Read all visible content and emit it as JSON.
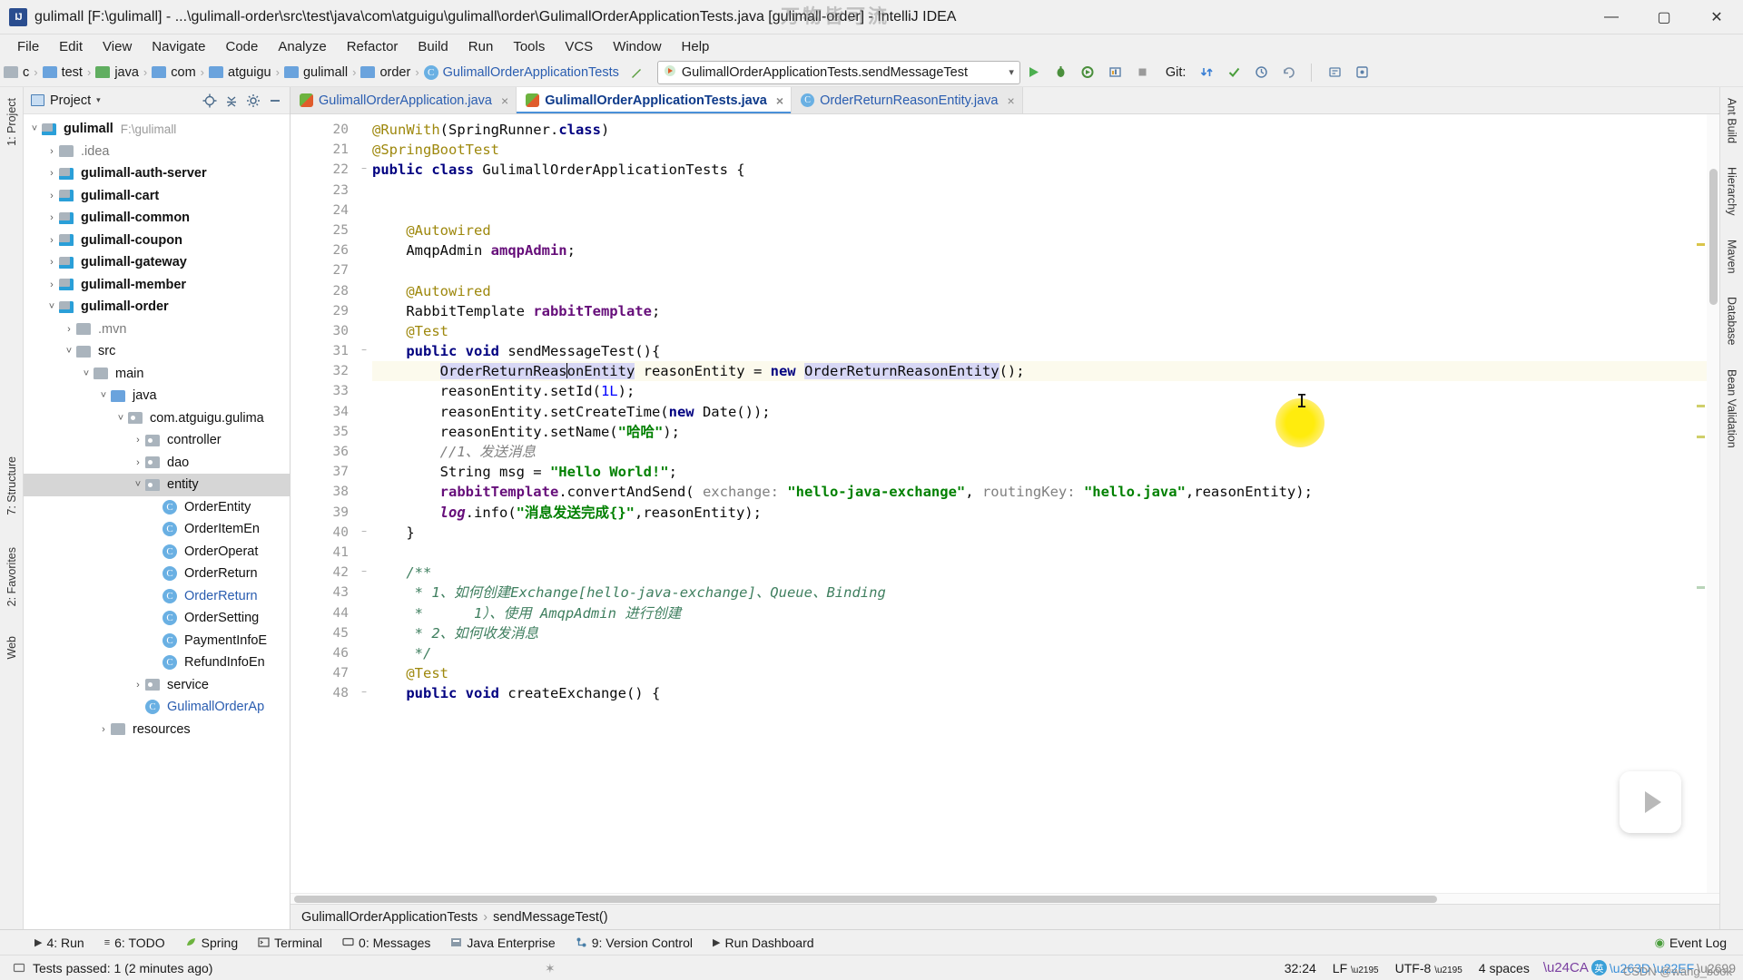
{
  "window": {
    "title": "gulimall [F:\\gulimall] - ...\\gulimall-order\\src\\test\\java\\com\\atguigu\\gulimall\\order\\GulimallOrderApplicationTests.java [gulimall-order] - IntelliJ IDEA",
    "app_icon_text": "IJ",
    "watermark": "万物皆可流",
    "minimize": "—",
    "maximize": "▢",
    "close": "✕"
  },
  "menubar": {
    "items": [
      "File",
      "Edit",
      "View",
      "Navigate",
      "Code",
      "Analyze",
      "Refactor",
      "Build",
      "Run",
      "Tools",
      "VCS",
      "Window",
      "Help"
    ]
  },
  "navbar": {
    "crumbs": [
      {
        "label": "c",
        "icon": "folder-icon",
        "color": "grey"
      },
      {
        "label": "test",
        "icon": "folder-icon",
        "color": "blue"
      },
      {
        "label": "java",
        "icon": "folder-icon",
        "color": "green"
      },
      {
        "label": "com",
        "icon": "folder-icon",
        "color": "blue"
      },
      {
        "label": "atguigu",
        "icon": "folder-icon",
        "color": "blue"
      },
      {
        "label": "gulimall",
        "icon": "folder-icon",
        "color": "blue"
      },
      {
        "label": "order",
        "icon": "folder-icon",
        "color": "blue"
      },
      {
        "label": "GulimallOrderApplicationTests",
        "icon": "class-icon",
        "color": "link"
      }
    ],
    "separator": "›",
    "run_config": "GulimallOrderApplicationTests.sendMessageTest",
    "run_config_caret": "▾",
    "git_label": "Git:",
    "buttons": {
      "run": "▶",
      "debug": "bug-icon",
      "run_with_coverage": "coverage-icon",
      "profile": "profile-icon",
      "stop": "■",
      "update_project": "↙",
      "commit": "✓",
      "history": "◴",
      "rollback": "↶",
      "search_everywhere": "⌕",
      "settings": "⚙"
    }
  },
  "left_strips": [
    {
      "label": "1: Project",
      "name": "tool-tab-project"
    },
    {
      "label": "7: Structure",
      "name": "tool-tab-structure"
    },
    {
      "label": "2: Favorites",
      "name": "tool-tab-favorites"
    },
    {
      "label": "Web",
      "name": "tool-tab-web"
    }
  ],
  "right_strips": [
    {
      "label": "Ant Build",
      "name": "tool-tab-ant-build"
    },
    {
      "label": "Hierarchy",
      "name": "tool-tab-hierarchy"
    },
    {
      "label": "Maven",
      "name": "tool-tab-maven"
    },
    {
      "label": "Database",
      "name": "tool-tab-database"
    },
    {
      "label": "Bean Validation",
      "name": "tool-tab-bean-validation"
    }
  ],
  "project_panel": {
    "title": "Project",
    "caret": "▾",
    "tree": [
      {
        "indent": 0,
        "arrow": "˅",
        "icon": "module-folder",
        "label": "gulimall",
        "bold": true,
        "path": "F:\\gulimall"
      },
      {
        "indent": 1,
        "arrow": "›",
        "icon": "folder",
        "label": ".idea",
        "dim": true
      },
      {
        "indent": 1,
        "arrow": "›",
        "icon": "module-folder",
        "label": "gulimall-auth-server",
        "bold": true
      },
      {
        "indent": 1,
        "arrow": "›",
        "icon": "module-folder",
        "label": "gulimall-cart",
        "bold": true
      },
      {
        "indent": 1,
        "arrow": "›",
        "icon": "module-folder",
        "label": "gulimall-common",
        "bold": true
      },
      {
        "indent": 1,
        "arrow": "›",
        "icon": "module-folder",
        "label": "gulimall-coupon",
        "bold": true
      },
      {
        "indent": 1,
        "arrow": "›",
        "icon": "module-folder",
        "label": "gulimall-gateway",
        "bold": true
      },
      {
        "indent": 1,
        "arrow": "›",
        "icon": "module-folder",
        "label": "gulimall-member",
        "bold": true
      },
      {
        "indent": 1,
        "arrow": "˅",
        "icon": "module-folder",
        "label": "gulimall-order",
        "bold": true
      },
      {
        "indent": 2,
        "arrow": "›",
        "icon": "folder",
        "label": ".mvn",
        "dim": true
      },
      {
        "indent": 2,
        "arrow": "˅",
        "icon": "folder",
        "label": "src"
      },
      {
        "indent": 3,
        "arrow": "˅",
        "icon": "folder",
        "label": "main"
      },
      {
        "indent": 4,
        "arrow": "˅",
        "icon": "source-folder",
        "label": "java"
      },
      {
        "indent": 5,
        "arrow": "˅",
        "icon": "package",
        "label": "com.atguigu.gulima"
      },
      {
        "indent": 6,
        "arrow": "›",
        "icon": "package",
        "label": "controller"
      },
      {
        "indent": 6,
        "arrow": "›",
        "icon": "package",
        "label": "dao"
      },
      {
        "indent": 6,
        "arrow": "˅",
        "icon": "package",
        "label": "entity",
        "selected": true
      },
      {
        "indent": 7,
        "arrow": "",
        "icon": "class",
        "label": "OrderEntity"
      },
      {
        "indent": 7,
        "arrow": "",
        "icon": "class",
        "label": "OrderItemEn"
      },
      {
        "indent": 7,
        "arrow": "",
        "icon": "class",
        "label": "OrderOperat"
      },
      {
        "indent": 7,
        "arrow": "",
        "icon": "class",
        "label": "OrderReturn"
      },
      {
        "indent": 7,
        "arrow": "",
        "icon": "class",
        "label": "OrderReturn",
        "blue": true
      },
      {
        "indent": 7,
        "arrow": "",
        "icon": "class",
        "label": "OrderSetting"
      },
      {
        "indent": 7,
        "arrow": "",
        "icon": "class",
        "label": "PaymentInfoE"
      },
      {
        "indent": 7,
        "arrow": "",
        "icon": "class",
        "label": "RefundInfoEn"
      },
      {
        "indent": 6,
        "arrow": "›",
        "icon": "package",
        "label": "service"
      },
      {
        "indent": 6,
        "arrow": "",
        "icon": "spring-class",
        "label": "GulimallOrderAp",
        "blue": true
      },
      {
        "indent": 4,
        "arrow": "›",
        "icon": "resource-folder",
        "label": "resources"
      }
    ]
  },
  "editor": {
    "tabs": [
      {
        "label": "GulimallOrderApplication.java",
        "icon": "spring-icon",
        "active": false,
        "close": "×"
      },
      {
        "label": "GulimallOrderApplicationTests.java",
        "icon": "spring-icon",
        "active": true,
        "close": "×"
      },
      {
        "label": "OrderReturnReasonEntity.java",
        "icon": "class-icon",
        "active": false,
        "close": "×"
      }
    ],
    "first_line_number": 20,
    "lines": [
      {
        "n": 20,
        "gutter_icon": "",
        "fold": "",
        "html": "<span class=\"an\">@RunWith</span>(SpringRunner.<span class=\"k\">class</span>)"
      },
      {
        "n": 21,
        "gutter_icon": "spring-leaf",
        "fold": "",
        "html": "<span class=\"an\">@SpringBootTest</span>"
      },
      {
        "n": 22,
        "gutter_icon": "run-test",
        "fold": "−",
        "html": "<span class=\"k\">public class</span> GulimallOrderApplicationTests {"
      },
      {
        "n": 23,
        "gutter_icon": "",
        "fold": "",
        "html": ""
      },
      {
        "n": 24,
        "gutter_icon": "",
        "fold": "",
        "html": ""
      },
      {
        "n": 25,
        "gutter_icon": "",
        "fold": "",
        "html": "    <span class=\"an\">@Autowired</span>"
      },
      {
        "n": 26,
        "gutter_icon": "bean",
        "fold": "",
        "html": "    AmqpAdmin <span class=\"fl\">amqpAdmin</span>;"
      },
      {
        "n": 27,
        "gutter_icon": "",
        "fold": "",
        "html": ""
      },
      {
        "n": 28,
        "gutter_icon": "",
        "fold": "",
        "html": "    <span class=\"an\">@Autowired</span>"
      },
      {
        "n": 29,
        "gutter_icon": "bean",
        "fold": "",
        "html": "    RabbitTemplate <span class=\"fl\">rabbitTemplate</span>;"
      },
      {
        "n": 30,
        "gutter_icon": "",
        "fold": "",
        "html": "    <span class=\"an\">@Test</span>"
      },
      {
        "n": 31,
        "gutter_icon": "run-test",
        "fold": "−",
        "html": "    <span class=\"k\">public void</span> sendMessageTest(){"
      },
      {
        "n": 32,
        "gutter_icon": "",
        "fold": "",
        "highlight": true,
        "html": "        <span class=\"sel-tok\">OrderReturnReas<span class=\"cursor\"></span>onEntity</span> reasonEntity = <span class=\"k\">new</span> <span class=\"sel-tok\">OrderReturnReasonEntity</span>();"
      },
      {
        "n": 33,
        "gutter_icon": "",
        "fold": "",
        "html": "        reasonEntity.setId(<span class=\"nm\">1L</span>);"
      },
      {
        "n": 34,
        "gutter_icon": "",
        "fold": "",
        "html": "        reasonEntity.setCreateTime(<span class=\"k\">new</span> Date());"
      },
      {
        "n": 35,
        "gutter_icon": "",
        "fold": "",
        "html": "        reasonEntity.setName(<span class=\"st\">\"哈哈\"</span>);"
      },
      {
        "n": 36,
        "gutter_icon": "",
        "fold": "",
        "html": "        <span class=\"cm\">//1、发送消息</span>"
      },
      {
        "n": 37,
        "gutter_icon": "",
        "fold": "",
        "html": "        String msg = <span class=\"st\">\"Hello World!\"</span>;"
      },
      {
        "n": 38,
        "gutter_icon": "",
        "fold": "",
        "html": "        <span class=\"fl\">rabbitTemplate</span>.convertAndSend( <span class=\"pm\">exchange:</span> <span class=\"st\">\"hello-java-exchange\"</span>, <span class=\"pm\">routingKey:</span> <span class=\"st\">\"hello.java\"</span>,reasonEntity);"
      },
      {
        "n": 39,
        "gutter_icon": "",
        "fold": "",
        "html": "        <span class=\"fl\" style=\"font-style:italic\">log</span>.info(<span class=\"st\">\"消息发送完成{}\"</span>,reasonEntity);"
      },
      {
        "n": 40,
        "gutter_icon": "",
        "fold": "−",
        "html": "    }"
      },
      {
        "n": 41,
        "gutter_icon": "",
        "fold": "",
        "html": ""
      },
      {
        "n": 42,
        "gutter_icon": "",
        "fold": "−",
        "html": "    <span class=\"jd\">/**</span>"
      },
      {
        "n": 43,
        "gutter_icon": "",
        "fold": "",
        "html": "     <span class=\"jd\">* 1、如何创建Exchange[hello-java-exchange]、Queue、Binding</span>"
      },
      {
        "n": 44,
        "gutter_icon": "",
        "fold": "",
        "html": "     <span class=\"jd\">*      1）、使用 AmqpAdmin 进行创建</span>"
      },
      {
        "n": 45,
        "gutter_icon": "",
        "fold": "",
        "html": "     <span class=\"jd\">* 2、如何收发消息</span>"
      },
      {
        "n": 46,
        "gutter_icon": "",
        "fold": "",
        "html": "     <span class=\"jd\">*/</span>"
      },
      {
        "n": 47,
        "gutter_icon": "",
        "fold": "",
        "html": "    <span class=\"an\">@Test</span>"
      },
      {
        "n": 48,
        "gutter_icon": "run-test",
        "fold": "−",
        "html": "    <span class=\"k\">public void</span> createExchange() {"
      }
    ],
    "breadcrumb": [
      "GulimallOrderApplicationTests",
      "sendMessageTest()"
    ],
    "breadcrumb_sep": "›"
  },
  "toolwindow_bar": {
    "items": [
      {
        "label": "4: Run",
        "icon": "▶"
      },
      {
        "label": "6: TODO",
        "icon": "≡"
      },
      {
        "label": "Spring",
        "icon": "spring-leaf-icon"
      },
      {
        "label": "Terminal",
        "icon": "terminal-icon"
      },
      {
        "label": "0: Messages",
        "icon": "message-icon"
      },
      {
        "label": "Java Enterprise",
        "icon": "java-ee-icon"
      },
      {
        "label": "9: Version Control",
        "icon": "vcs-icon"
      },
      {
        "label": "Run Dashboard",
        "icon": "▶"
      }
    ],
    "event_log": {
      "label": "Event Log",
      "icon": "⬤"
    }
  },
  "statusbar": {
    "message": "Tests passed: 1 (2 minutes ago)",
    "caret_position": "32:24",
    "line_separator": "LF",
    "encoding": "UTF-8",
    "indent": "4 spaces",
    "ime": "英",
    "spinner": "✶",
    "watermark": "CSDN @wang_book"
  }
}
